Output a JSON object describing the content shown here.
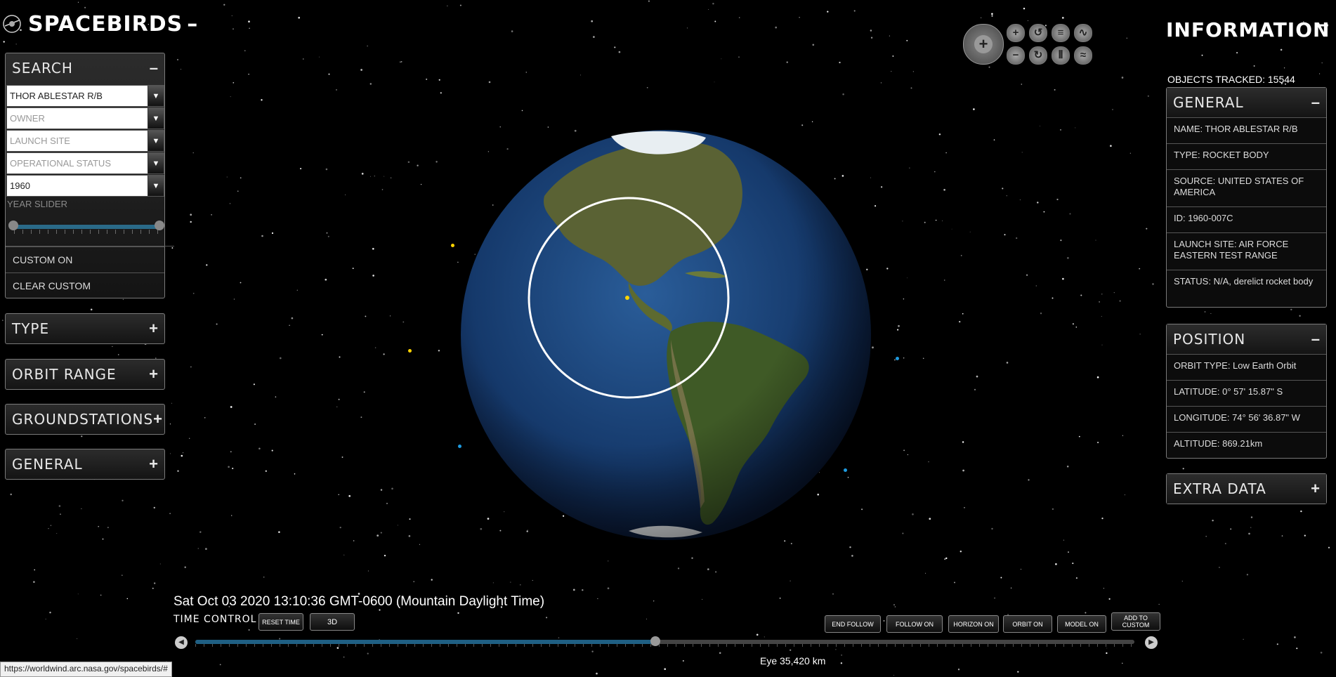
{
  "app": {
    "title": "SPACEBIRDS",
    "minimize": "–"
  },
  "search": {
    "heading": "SEARCH",
    "collapse": "–",
    "fields": [
      {
        "value": "THOR ABLESTAR R/B",
        "placeholder": false
      },
      {
        "value": "OWNER",
        "placeholder": true
      },
      {
        "value": "LAUNCH SITE",
        "placeholder": true
      },
      {
        "value": "OPERATIONAL STATUS",
        "placeholder": true
      },
      {
        "value": "1960",
        "placeholder": false
      }
    ],
    "year_slider_label": "YEAR SLIDER",
    "custom_on": "CUSTOM ON",
    "clear_custom": "CLEAR CUSTOM"
  },
  "left_panels": [
    {
      "label": "TYPE",
      "sign": "+"
    },
    {
      "label": "ORBIT RANGE",
      "sign": "+"
    },
    {
      "label": "GROUNDSTATIONS",
      "sign": "+"
    },
    {
      "label": "GENERAL",
      "sign": "+"
    }
  ],
  "info": {
    "title": "INFORMATION",
    "minimize": "–",
    "objects_tracked": "OBJECTS TRACKED: 15544",
    "general": {
      "heading": "GENERAL",
      "sign": "–",
      "rows": [
        "NAME: THOR ABLESTAR R/B",
        "TYPE: ROCKET BODY",
        "SOURCE: UNITED STATES OF AMERICA",
        "ID: 1960-007C",
        "LAUNCH SITE: AIR FORCE EASTERN TEST RANGE",
        "STATUS: N/A, derelict rocket body"
      ]
    },
    "position": {
      "heading": "POSITION",
      "sign": "–",
      "rows": [
        "ORBIT TYPE: Low Earth Orbit",
        "LATITUDE: 0° 57' 15.87\" S",
        "LONGITUDE: 74° 56' 36.87\" W",
        "ALTITUDE: 869.21km"
      ]
    },
    "extra": {
      "heading": "EXTRA DATA",
      "sign": "+"
    }
  },
  "controls": {
    "nav_icon": "pan-compass-icon",
    "buttons": [
      {
        "name": "zoom-in-icon",
        "glyph": "+"
      },
      {
        "name": "rotate-left-icon",
        "glyph": "↺"
      },
      {
        "name": "tilt-up-icon",
        "glyph": "≡"
      },
      {
        "name": "tilt-wave-icon",
        "glyph": "∿"
      },
      {
        "name": "zoom-out-icon",
        "glyph": "−"
      },
      {
        "name": "rotate-right-icon",
        "glyph": "↻"
      },
      {
        "name": "tilt-reset-icon",
        "glyph": "⦀"
      },
      {
        "name": "tilt-down-icon",
        "glyph": "≈"
      }
    ]
  },
  "time": {
    "datetime": "Sat Oct 03 2020 13:10:36 GMT-0600 (Mountain Daylight Time)",
    "label": "TIME CONTROL",
    "reset": "RESET TIME",
    "mode": "3D",
    "progress": 0.49
  },
  "view_buttons": [
    "END FOLLOW",
    "FOLLOW ON",
    "HORIZON ON",
    "ORBIT ON",
    "MODEL ON",
    "ADD TO CUSTOM"
  ],
  "eye": "Eye  35,420 km",
  "status_url": "https://worldwind.arc.nasa.gov/spacebirds/#",
  "colors": {
    "ocean": "#1b3f73",
    "land": "#4d5a2c",
    "accent": "#1f5f83"
  }
}
